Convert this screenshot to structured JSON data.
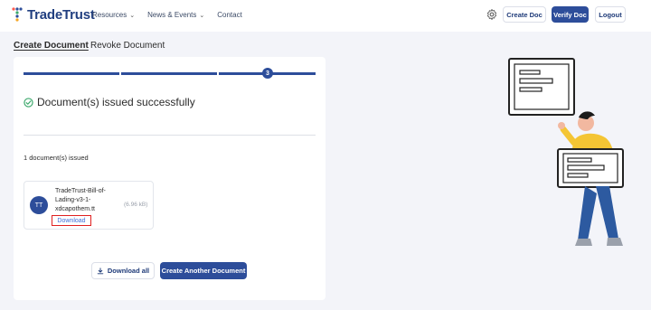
{
  "header": {
    "logo_text": "TradeTrust",
    "nav": [
      {
        "label": "Resources",
        "has_dropdown": true
      },
      {
        "label": "News & Events",
        "has_dropdown": true
      },
      {
        "label": "Contact",
        "has_dropdown": false
      }
    ],
    "settings_icon": "gear-icon",
    "create_doc_label": "Create Doc",
    "verify_doc_label": "Verify Doc",
    "logout_label": "Logout"
  },
  "tabs": [
    {
      "label": "Create Document",
      "active": true
    },
    {
      "label": "Revoke Document",
      "active": false
    }
  ],
  "progress": {
    "current_step": "3"
  },
  "result": {
    "success_icon": "check-circle-icon",
    "success_message": "Document(s) issued successfully",
    "issued_count": "1 document(s) issued"
  },
  "document": {
    "avatar_initials": "TT",
    "name_line1": "TradeTrust-Bill-of-",
    "name_line2": "Lading-v3-1-",
    "name_line3": "xdcapothem.tt",
    "size": "(6.96 kB)",
    "download_label": "Download"
  },
  "actions": {
    "download_all_label": "Download all",
    "download_icon": "download-icon",
    "create_another_label": "Create Another Document"
  },
  "colors": {
    "brand": "#2d4d9a",
    "success": "#3ba86b",
    "highlight": "#e02020",
    "link": "#3f6fd8"
  }
}
